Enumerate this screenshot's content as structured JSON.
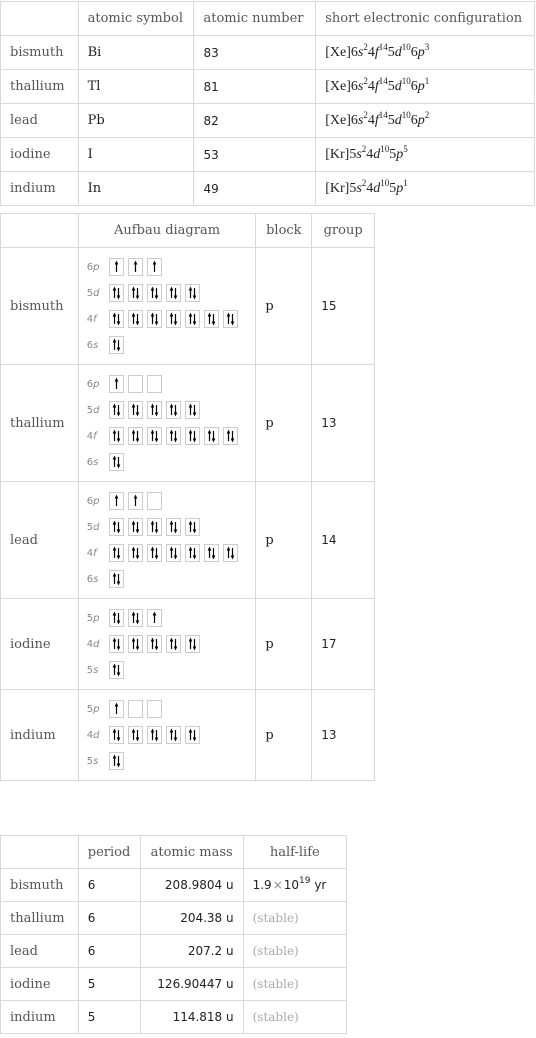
{
  "table1": {
    "headers": [
      "",
      "atomic symbol",
      "atomic number",
      "short electronic configuration"
    ],
    "rows": [
      {
        "name": "bismuth",
        "symbol": "Bi",
        "number": "83",
        "config": [
          {
            "t": "[Xe]6"
          },
          {
            "i": "s"
          },
          {
            "sup": "2"
          },
          {
            "t": "4"
          },
          {
            "i": "f"
          },
          {
            "sup": "14"
          },
          {
            "t": "5"
          },
          {
            "i": "d"
          },
          {
            "sup": "10"
          },
          {
            "t": "6"
          },
          {
            "i": "p"
          },
          {
            "sup": "3"
          }
        ]
      },
      {
        "name": "thallium",
        "symbol": "Tl",
        "number": "81",
        "config": [
          {
            "t": "[Xe]6"
          },
          {
            "i": "s"
          },
          {
            "sup": "2"
          },
          {
            "t": "4"
          },
          {
            "i": "f"
          },
          {
            "sup": "14"
          },
          {
            "t": "5"
          },
          {
            "i": "d"
          },
          {
            "sup": "10"
          },
          {
            "t": "6"
          },
          {
            "i": "p"
          },
          {
            "sup": "1"
          }
        ]
      },
      {
        "name": "lead",
        "symbol": "Pb",
        "number": "82",
        "config": [
          {
            "t": "[Xe]6"
          },
          {
            "i": "s"
          },
          {
            "sup": "2"
          },
          {
            "t": "4"
          },
          {
            "i": "f"
          },
          {
            "sup": "14"
          },
          {
            "t": "5"
          },
          {
            "i": "d"
          },
          {
            "sup": "10"
          },
          {
            "t": "6"
          },
          {
            "i": "p"
          },
          {
            "sup": "2"
          }
        ]
      },
      {
        "name": "iodine",
        "symbol": "I",
        "number": "53",
        "config": [
          {
            "t": "[Kr]5"
          },
          {
            "i": "s"
          },
          {
            "sup": "2"
          },
          {
            "t": "4"
          },
          {
            "i": "d"
          },
          {
            "sup": "10"
          },
          {
            "t": "5"
          },
          {
            "i": "p"
          },
          {
            "sup": "5"
          }
        ]
      },
      {
        "name": "indium",
        "symbol": "In",
        "number": "49",
        "config": [
          {
            "t": "[Kr]5"
          },
          {
            "i": "s"
          },
          {
            "sup": "2"
          },
          {
            "t": "4"
          },
          {
            "i": "d"
          },
          {
            "sup": "10"
          },
          {
            "t": "5"
          },
          {
            "i": "p"
          },
          {
            "sup": "1"
          }
        ]
      }
    ]
  },
  "table2": {
    "headers": [
      "",
      "Aufbau diagram",
      "block",
      "group"
    ],
    "rows": [
      {
        "name": "bismuth",
        "block": "p",
        "group": "15",
        "orbitals": [
          {
            "n": "6",
            "l": "p",
            "boxes": [
              "u",
              "u",
              "u"
            ]
          },
          {
            "n": "5",
            "l": "d",
            "boxes": [
              "ud",
              "ud",
              "ud",
              "ud",
              "ud"
            ]
          },
          {
            "n": "4",
            "l": "f",
            "boxes": [
              "ud",
              "ud",
              "ud",
              "ud",
              "ud",
              "ud",
              "ud"
            ]
          },
          {
            "n": "6",
            "l": "s",
            "boxes": [
              "ud"
            ]
          }
        ]
      },
      {
        "name": "thallium",
        "block": "p",
        "group": "13",
        "orbitals": [
          {
            "n": "6",
            "l": "p",
            "boxes": [
              "u",
              "",
              ""
            ]
          },
          {
            "n": "5",
            "l": "d",
            "boxes": [
              "ud",
              "ud",
              "ud",
              "ud",
              "ud"
            ]
          },
          {
            "n": "4",
            "l": "f",
            "boxes": [
              "ud",
              "ud",
              "ud",
              "ud",
              "ud",
              "ud",
              "ud"
            ]
          },
          {
            "n": "6",
            "l": "s",
            "boxes": [
              "ud"
            ]
          }
        ]
      },
      {
        "name": "lead",
        "block": "p",
        "group": "14",
        "orbitals": [
          {
            "n": "6",
            "l": "p",
            "boxes": [
              "u",
              "u",
              ""
            ]
          },
          {
            "n": "5",
            "l": "d",
            "boxes": [
              "ud",
              "ud",
              "ud",
              "ud",
              "ud"
            ]
          },
          {
            "n": "4",
            "l": "f",
            "boxes": [
              "ud",
              "ud",
              "ud",
              "ud",
              "ud",
              "ud",
              "ud"
            ]
          },
          {
            "n": "6",
            "l": "s",
            "boxes": [
              "ud"
            ]
          }
        ]
      },
      {
        "name": "iodine",
        "block": "p",
        "group": "17",
        "orbitals": [
          {
            "n": "5",
            "l": "p",
            "boxes": [
              "ud",
              "ud",
              "u"
            ]
          },
          {
            "n": "4",
            "l": "d",
            "boxes": [
              "ud",
              "ud",
              "ud",
              "ud",
              "ud"
            ]
          },
          {
            "n": "5",
            "l": "s",
            "boxes": [
              "ud"
            ]
          }
        ]
      },
      {
        "name": "indium",
        "block": "p",
        "group": "13",
        "orbitals": [
          {
            "n": "5",
            "l": "p",
            "boxes": [
              "u",
              "",
              ""
            ]
          },
          {
            "n": "4",
            "l": "d",
            "boxes": [
              "ud",
              "ud",
              "ud",
              "ud",
              "ud"
            ]
          },
          {
            "n": "5",
            "l": "s",
            "boxes": [
              "ud"
            ]
          }
        ]
      }
    ]
  },
  "table3": {
    "headers": [
      "",
      "period",
      "atomic mass",
      "half-life"
    ],
    "rows": [
      {
        "name": "bismuth",
        "period": "6",
        "mass": "208.9804 u",
        "halflife": {
          "mantissa": "1.9",
          "times": "×",
          "base": "10",
          "exp": "19",
          "unit": " yr"
        }
      },
      {
        "name": "thallium",
        "period": "6",
        "mass": "204.38 u",
        "halflife": {
          "text": "(stable)"
        }
      },
      {
        "name": "lead",
        "period": "6",
        "mass": "207.2 u",
        "halflife": {
          "text": "(stable)"
        }
      },
      {
        "name": "iodine",
        "period": "5",
        "mass": "126.90447 u",
        "halflife": {
          "text": "(stable)"
        }
      },
      {
        "name": "indium",
        "period": "5",
        "mass": "114.818 u",
        "halflife": {
          "text": "(stable)"
        }
      }
    ]
  }
}
